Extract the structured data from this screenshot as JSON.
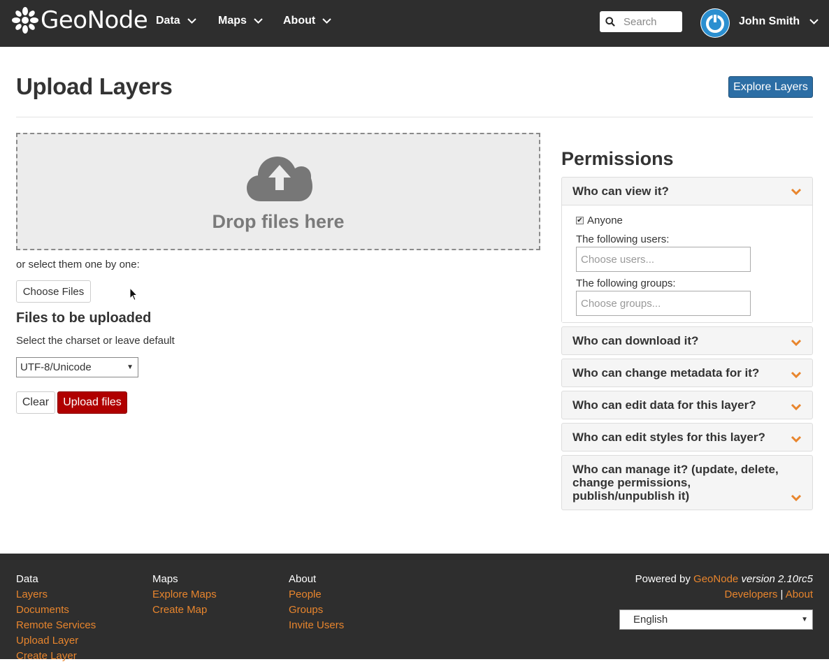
{
  "navbar": {
    "brand": "GeoNode",
    "menus": [
      {
        "label": "Data"
      },
      {
        "label": "Maps"
      },
      {
        "label": "About"
      }
    ],
    "search_placeholder": "Search",
    "user_name": "John Smith"
  },
  "header": {
    "title": "Upload Layers",
    "explore_button": "Explore Layers"
  },
  "upload": {
    "drop_text": "Drop files here",
    "select_one_text": "or select them one by one:",
    "choose_button": "Choose Files",
    "files_title": "Files to be uploaded",
    "charset_label": "Select the charset or leave default",
    "charset_value": "UTF-8/Unicode",
    "clear_button": "Clear",
    "upload_button": "Upload files"
  },
  "permissions": {
    "title": "Permissions",
    "view": {
      "heading": "Who can view it?",
      "anyone_label": "Anyone",
      "anyone_checked": true,
      "users_label": "The following users:",
      "users_placeholder": "Choose users...",
      "groups_label": "The following groups:",
      "groups_placeholder": "Choose groups..."
    },
    "panels": [
      "Who can download it?",
      "Who can change metadata for it?",
      "Who can edit data for this layer?",
      "Who can edit styles for this layer?",
      "Who can manage it? (update, delete, change permissions, publish/unpublish it)"
    ]
  },
  "footer": {
    "columns": [
      {
        "heading": "Data",
        "links": [
          "Layers",
          "Documents",
          "Remote Services",
          "Upload Layer",
          "Create Layer"
        ]
      },
      {
        "heading": "Maps",
        "links": [
          "Explore Maps",
          "Create Map"
        ]
      },
      {
        "heading": "About",
        "links": [
          "People",
          "Groups",
          "Invite Users"
        ]
      }
    ],
    "powered_by": "Powered by",
    "geonode_link": "GeoNode",
    "version": "version 2.10rc5",
    "developers_link": "Developers",
    "separator": "|",
    "about_link": "About",
    "language": "English"
  },
  "colors": {
    "navbar_bg": "#2e2e2e",
    "primary_button": "#2c6ea5",
    "danger_button": "#b00000",
    "footer_link": "#e8852d",
    "caret": "#e8852d"
  }
}
